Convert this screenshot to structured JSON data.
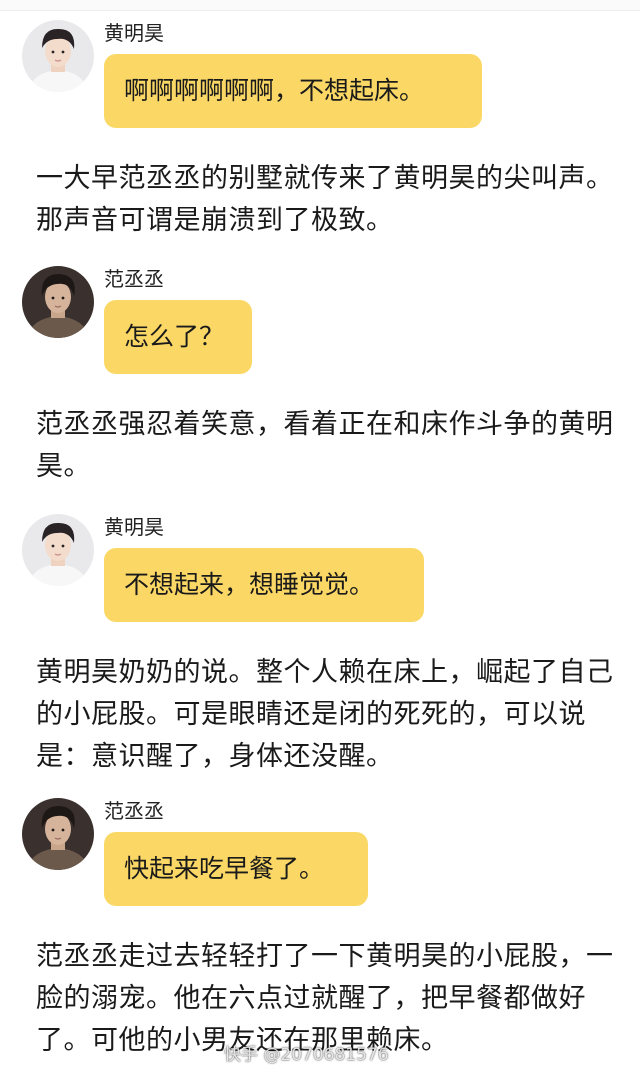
{
  "conversation": [
    {
      "speaker": "黄明昊",
      "avatar_icon": "boy-portrait-light-icon",
      "bubble": "啊啊啊啊啊啊，不想起床。",
      "narration": "一大早范丞丞的别墅就传来了黄明昊的尖叫声。那声音可谓是崩溃到了极致。"
    },
    {
      "speaker": "范丞丞",
      "avatar_icon": "boy-portrait-dark-icon",
      "bubble": "怎么了？",
      "narration": "范丞丞强忍着笑意，看着正在和床作斗争的黄明昊。"
    },
    {
      "speaker": "黄明昊",
      "avatar_icon": "boy-portrait-light-icon",
      "bubble": "不想起来，想睡觉觉。",
      "narration": "黄明昊奶奶的说。整个人赖在床上，崛起了自己的小屁股。可是眼睛还是闭的死死的，可以说是：意识醒了，身体还没醒。"
    },
    {
      "speaker": "范丞丞",
      "avatar_icon": "boy-portrait-dark-icon",
      "bubble": "快起来吃早餐了。",
      "narration": "范丞丞走过去轻轻打了一下黄明昊的小屁股，一脸的溺宠。他在六点过就醒了，把早餐都做好了。可他的小男友还在那里赖床。"
    }
  ],
  "watermark": "快手 @2070681576",
  "colors": {
    "bubble": "#fbd866",
    "text": "#1a1a1a",
    "background": "#ffffff"
  }
}
